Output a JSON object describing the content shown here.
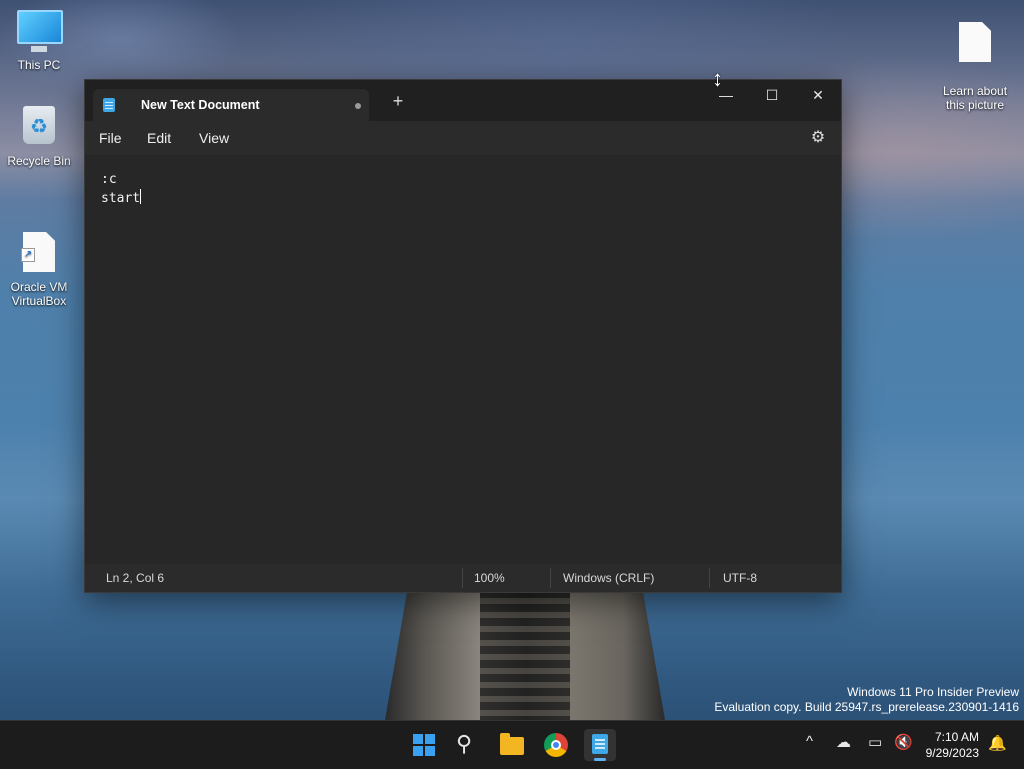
{
  "desktop": {
    "icons": [
      {
        "label": "This PC"
      },
      {
        "label": "Recycle Bin"
      },
      {
        "label": "Oracle VM\nVirtualBox"
      },
      {
        "label": "Learn about\nthis picture"
      }
    ]
  },
  "notepad": {
    "tab_title": "New Text Document",
    "new_tab_symbol": "+",
    "window_controls": {
      "minimize": "—",
      "maximize": "☐",
      "close": "✕"
    },
    "menu": {
      "file": "File",
      "edit": "Edit",
      "view": "View"
    },
    "settings_icon": "gear-icon",
    "content_line1": ":c",
    "content_line2": "start",
    "status": {
      "position": "Ln 2, Col 6",
      "zoom": "100%",
      "line_ending": "Windows (CRLF)",
      "encoding": "UTF-8"
    }
  },
  "watermark": {
    "line1": "Windows 11 Pro Insider Preview",
    "line2": "Evaluation copy. Build 25947.rs_prerelease.230901-1416"
  },
  "taskbar": {
    "apps": [
      "start-icon",
      "search-icon",
      "file-explorer-icon",
      "chrome-icon",
      "notepad-icon"
    ],
    "tray_chevron": "^",
    "time": "7:10 AM",
    "date": "9/29/2023"
  },
  "colors": {
    "accent": "#3ea8e6",
    "window_bg": "#202020",
    "editor_bg": "#272727"
  }
}
